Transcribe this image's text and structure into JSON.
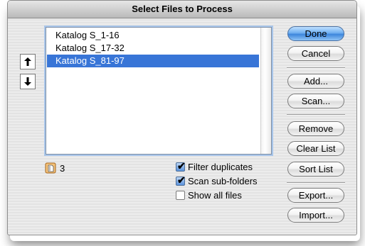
{
  "window": {
    "title": "Select Files to Process"
  },
  "files": [
    {
      "name": "Katalog S_1-16",
      "selected": false
    },
    {
      "name": "Katalog S_17-32",
      "selected": false
    },
    {
      "name": "Katalog S_81-97",
      "selected": true
    }
  ],
  "move_buttons": {
    "up_icon": "arrow-up-icon",
    "down_icon": "arrow-down-icon"
  },
  "count": {
    "icon": "document-icon",
    "value": "3"
  },
  "options": {
    "filter_duplicates": {
      "label": "Filter duplicates",
      "checked": true
    },
    "scan_subfolders": {
      "label": "Scan sub-folders",
      "checked": true
    },
    "show_all_files": {
      "label": "Show all files",
      "checked": false
    }
  },
  "buttons": {
    "done": "Done",
    "cancel": "Cancel",
    "add": "Add...",
    "scan": "Scan...",
    "remove": "Remove",
    "clear_list": "Clear List",
    "sort_list": "Sort List",
    "export": "Export...",
    "import": "Import..."
  },
  "colors": {
    "selection": "#3875d7",
    "default_button": "#3d86dc",
    "focus_ring": "#a9c6ea"
  }
}
